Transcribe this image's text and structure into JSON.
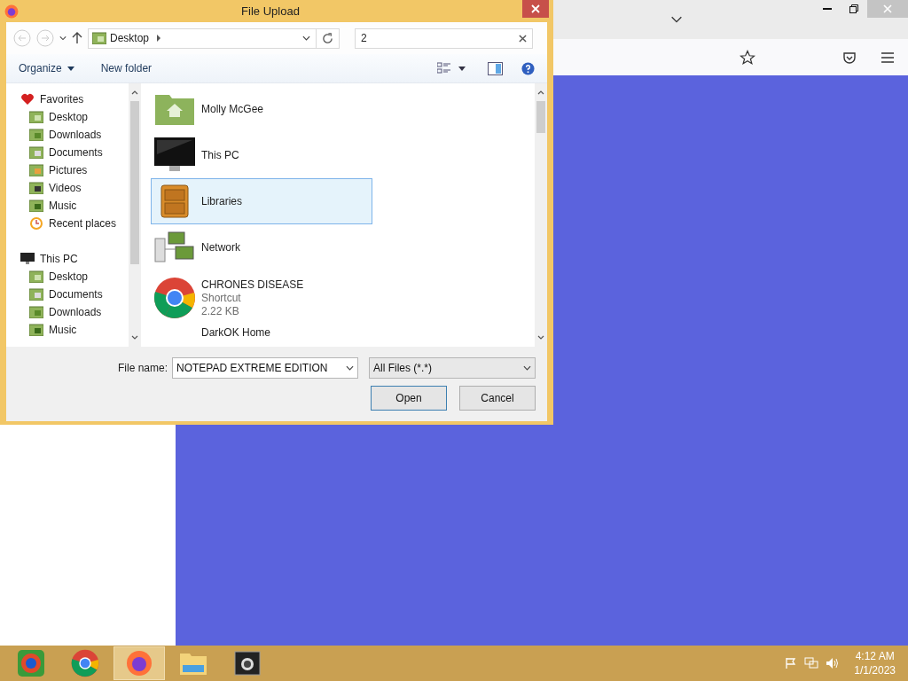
{
  "dialog": {
    "title": "File Upload",
    "address": "Desktop",
    "search": {
      "value": "2"
    },
    "toolbar": {
      "organize": "Organize",
      "new_folder": "New folder"
    },
    "sidebar": [
      {
        "label": "Favorites",
        "kind": "favorites",
        "children": [
          {
            "label": "Desktop",
            "kind": "desktop"
          },
          {
            "label": "Downloads",
            "kind": "downloads"
          },
          {
            "label": "Documents",
            "kind": "documents"
          },
          {
            "label": "Pictures",
            "kind": "pictures"
          },
          {
            "label": "Videos",
            "kind": "videos"
          },
          {
            "label": "Music",
            "kind": "music"
          },
          {
            "label": "Recent places",
            "kind": "recent"
          }
        ]
      },
      {
        "label": "This PC",
        "kind": "pc",
        "children": [
          {
            "label": "Desktop",
            "kind": "desktop"
          },
          {
            "label": "Documents",
            "kind": "documents"
          },
          {
            "label": "Downloads",
            "kind": "downloads"
          },
          {
            "label": "Music",
            "kind": "music"
          }
        ]
      }
    ],
    "files": [
      {
        "name": "Molly McGee",
        "kind": "user-folder",
        "selected": false
      },
      {
        "name": "This PC",
        "kind": "pc",
        "selected": false
      },
      {
        "name": "Libraries",
        "kind": "library",
        "selected": true
      },
      {
        "name": "Network",
        "kind": "network",
        "selected": false
      },
      {
        "name": "CHRONES DISEASE",
        "kind": "shortcut",
        "details": [
          "Shortcut",
          "2.22 KB"
        ],
        "selected": false
      },
      {
        "name": "DarkOK Home",
        "selected": false
      }
    ],
    "file_name_label": "File name:",
    "file_name": "NOTEPAD EXTREME EDITION",
    "filter": "All Files (*.*)",
    "buttons": [
      {
        "label": "Open",
        "selected": true
      },
      {
        "label": "Cancel",
        "selected": false
      }
    ]
  },
  "taskbar": {
    "apps": [
      {
        "kind": "chrome-beta",
        "selected": false
      },
      {
        "kind": "chrome",
        "selected": false
      },
      {
        "kind": "firefox",
        "selected": true
      },
      {
        "kind": "explorer",
        "selected": false
      },
      {
        "kind": "terminal",
        "selected": false
      }
    ],
    "time": "4:12 AM",
    "date": "1/1/2023"
  }
}
